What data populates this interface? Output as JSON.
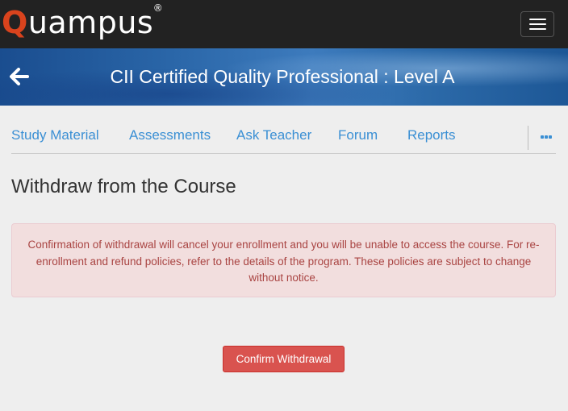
{
  "header": {
    "logo_first_letter": "Q",
    "logo_rest": "uampus",
    "logo_registered": "®",
    "menu_icon": "hamburger-menu-icon"
  },
  "banner": {
    "back_icon": "arrow-left-icon",
    "title": "CII Certified Quality Professional : Level A"
  },
  "nav": {
    "tabs": [
      {
        "label": "Study Material"
      },
      {
        "label": "Assessments"
      },
      {
        "label": "Ask Teacher"
      },
      {
        "label": "Forum"
      },
      {
        "label": "Reports"
      }
    ],
    "more_icon": "ellipsis-icon"
  },
  "main": {
    "heading": "Withdraw from the Course",
    "alert_text": "Confirmation of withdrawal will cancel your enrollment and you will be unable to access the course.  For re-enrollment and refund policies, refer to the details of the program. These policies are subject to change without notice.",
    "confirm_label": "Confirm Withdrawal"
  },
  "colors": {
    "topbar": "#222222",
    "logo_accent": "#d9431d",
    "link": "#3a8fd4",
    "alert_bg": "#f2dede",
    "alert_text": "#a94442",
    "danger_button": "#d9534f"
  }
}
